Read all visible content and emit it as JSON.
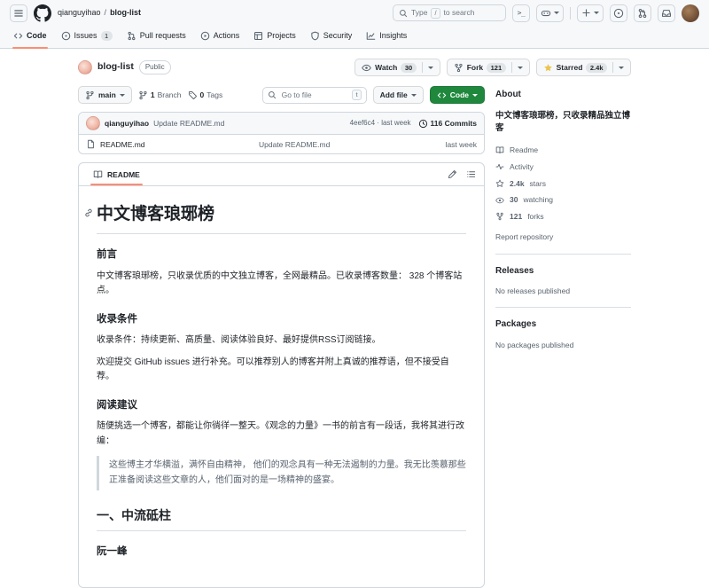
{
  "header": {
    "breadcrumb": {
      "owner": "qianguyihao",
      "separator": "/",
      "repo": "blog-list"
    },
    "search": {
      "pre": "Type",
      "key": "/",
      "post": "to search"
    },
    "terminal_hint": ">_",
    "plus": "+"
  },
  "nav": {
    "tabs": [
      {
        "label": "Code"
      },
      {
        "label": "Issues",
        "badge": "1"
      },
      {
        "label": "Pull requests"
      },
      {
        "label": "Actions"
      },
      {
        "label": "Projects"
      },
      {
        "label": "Security"
      },
      {
        "label": "Insights"
      }
    ]
  },
  "repo": {
    "name": "blog-list",
    "visibility": "Public",
    "watch": {
      "label": "Watch",
      "count": "30"
    },
    "fork": {
      "label": "Fork",
      "count": "121"
    },
    "star": {
      "label": "Starred",
      "count": "2.4k"
    }
  },
  "toolbar": {
    "branch": "main",
    "branches_count": "1",
    "branches_label": "Branch",
    "tags_count": "0",
    "tags_label": "Tags",
    "goto_placeholder": "Go to file",
    "goto_key": "t",
    "add_file": "Add file",
    "code": "Code"
  },
  "commit": {
    "author": "qianguyihao",
    "message": "Update README.md",
    "sha_time": "4eef6c4 · last week",
    "history": "116 Commits"
  },
  "file_row": {
    "name": "README.md",
    "message": "Update README.md",
    "time": "last week"
  },
  "readme": {
    "tab": "README",
    "title": "中文博客琅琊榜",
    "s1_heading": "前言",
    "s1_p1": "中文博客琅琊榜，只收录优质的中文独立博客，全网最精品。已收录博客数量： 328 个博客站点。",
    "s2_heading": "收录条件",
    "s2_p1": "收录条件：持续更新、高质量、阅读体验良好、最好提供RSS订阅链接。",
    "s2_p2": "欢迎提交 GitHub issues 进行补充。可以推荐别人的博客并附上真诚的推荐语，但不接受自荐。",
    "s3_heading": "阅读建议",
    "s3_p1": "随便挑选一个博客，都能让你徜徉一整天。《观念的力量》一书的前言有一段话，我将其进行改编：",
    "s3_quote": "这些博主才华横溢，满怀自由精神， 他们的观念具有一种无法遏制的力量。我无比羡慕那些正准备阅读这些文章的人，他们面对的是一场精神的盛宴。",
    "s4_heading": "一、中流砥柱",
    "s4_sub": "阮一峰"
  },
  "sidebar": {
    "about": {
      "heading": "About",
      "description": "中文博客琅琊榜，只收录精品独立博客",
      "items": [
        {
          "label": "Readme"
        },
        {
          "label": "Activity"
        },
        {
          "count": "2.4k",
          "label": "stars"
        },
        {
          "count": "30",
          "label": "watching"
        },
        {
          "count": "121",
          "label": "forks"
        }
      ],
      "report": "Report repository"
    },
    "releases": {
      "heading": "Releases",
      "empty": "No releases published"
    },
    "packages": {
      "heading": "Packages",
      "empty": "No packages published"
    }
  },
  "colors": {
    "accent_green": "#1f883d",
    "tab_underline": "#fd8c73",
    "star_yellow": "#eac54f"
  }
}
